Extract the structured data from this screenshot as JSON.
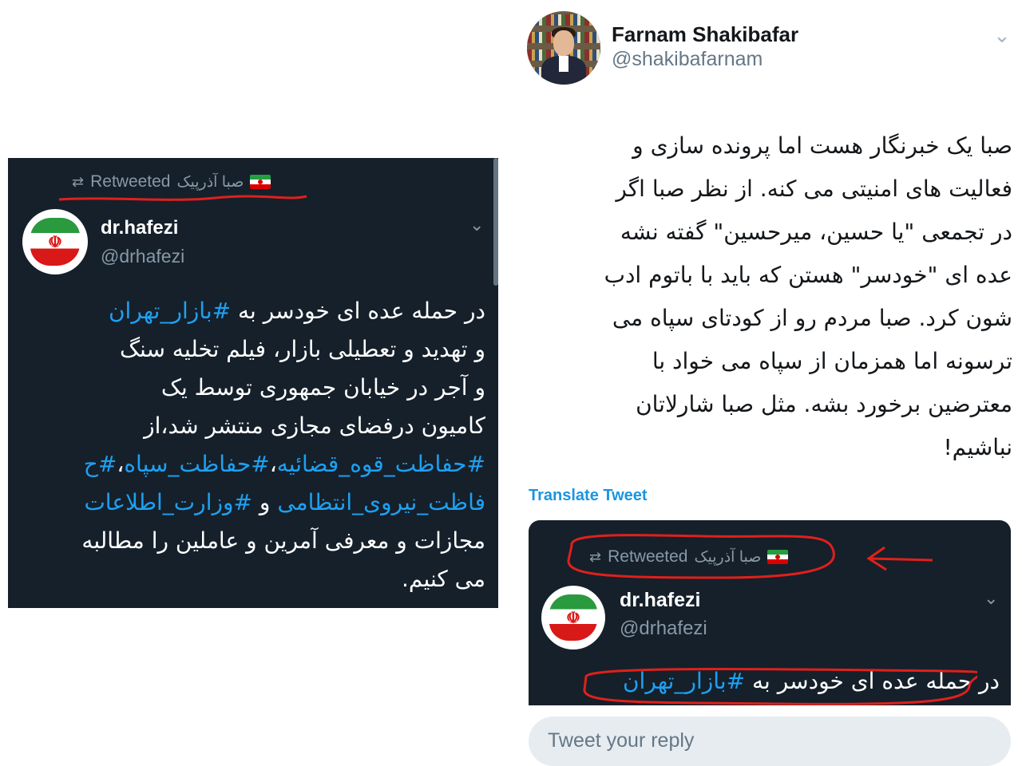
{
  "left_tweet": {
    "retweet_label": "Retweeted",
    "retweeter_name": "صبا آذرپیک",
    "retweet_icon": "retweet-icon",
    "author_name": "dr.hafezi",
    "author_handle": "@drhafezi",
    "lines": [
      [
        "در حمله عده ای خودسر به ",
        {
          "tag": "#بازار_تهران"
        }
      ],
      [
        "و تهدید و تعطیلی بازار، فیلم تخلیه سنگ"
      ],
      [
        "و آجر در خیابان جمهوری توسط یک"
      ],
      [
        "کامیون درفضای مجازی منتشر شد،از"
      ],
      [
        {
          "tag": "#حفاظت_قوه_قضائیه"
        },
        "،",
        {
          "tag": "#حفاظت_سپاه"
        },
        "،",
        {
          "tag": "#ح"
        }
      ],
      [
        {
          "tag": "فاظت_نیروی_انتظامی"
        },
        " و ",
        {
          "tag": "#وزارت_اطلاعات"
        }
      ],
      [
        "مجازات و معرفی آمرین و عاملین را مطالبه"
      ],
      [
        "می کنیم."
      ]
    ]
  },
  "main_tweet": {
    "author_name": "Farnam Shakibafar",
    "author_handle": "@shakibafarnam",
    "body_lines": [
      "صبا یک خبرنگار هست اما پرونده سازی و",
      "فعالیت های امنیتی می کنه. از نظر صبا اگر",
      "در تجمعی \"یا حسین، میرحسین\" گفته نشه",
      "عده ای \"خودسر\" هستن که باید با باتوم ادب",
      "شون کرد. صبا مردم رو از کودتای سپاه می",
      "ترسونه اما همزمان از سپاه می خواد با",
      "معترضین برخورد بشه. مثل صبا شارلاتان",
      "نباشیم!"
    ],
    "translate_label": "Translate Tweet"
  },
  "quoted_tweet": {
    "retweet_label": "Retweeted",
    "retweeter_name": "صبا آذرپیک",
    "author_name": "dr.hafezi",
    "author_handle": "@drhafezi",
    "first_line_text": "در حمله عده ای خودسر به ",
    "first_line_tag": "#بازار_تهران"
  },
  "reply": {
    "placeholder": "Tweet your reply"
  },
  "icons": {
    "retweet": "retweet-icon",
    "chevron": "chevron-down-icon",
    "flag": "iran-flag-icon"
  },
  "colors": {
    "dark_bg": "#15202b",
    "hashtag": "#1da1f2",
    "link": "#1b95e0",
    "annotation_red": "#e0201b",
    "reply_bg": "#e6ecf0"
  }
}
